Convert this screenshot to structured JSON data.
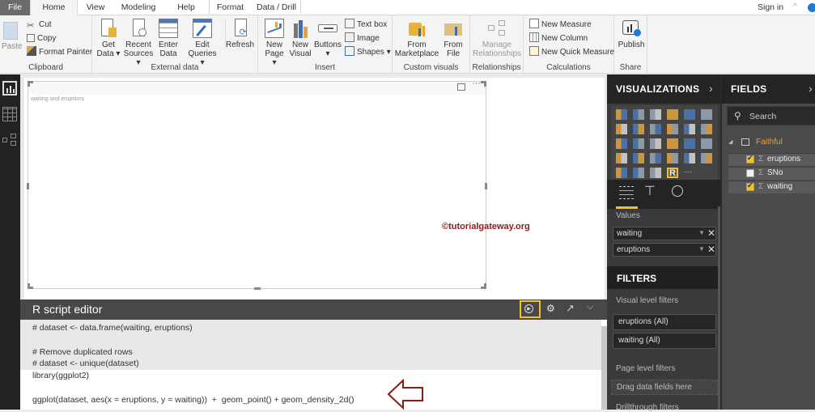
{
  "tabs": [
    "File",
    "Home",
    "View",
    "Modeling",
    "Help",
    "Format",
    "Data / Drill"
  ],
  "active_tab": "Home",
  "signin": "Sign in",
  "ribbon": {
    "clipboard": {
      "label": "Clipboard",
      "paste": "Paste",
      "cut": "Cut",
      "copy": "Copy",
      "format_painter": "Format Painter"
    },
    "external_data": {
      "label": "External data",
      "get_data": [
        "Get",
        "Data ▾"
      ],
      "recent_sources": [
        "Recent",
        "Sources ▾"
      ],
      "enter_data": [
        "Enter",
        "Data"
      ],
      "edit_queries": [
        "Edit",
        "Queries ▾"
      ],
      "refresh": "Refresh"
    },
    "insert": {
      "label": "Insert",
      "new_page": [
        "New",
        "Page ▾"
      ],
      "new_visual": [
        "New",
        "Visual"
      ],
      "buttons": [
        "Buttons",
        "▾"
      ],
      "text_box": "Text box",
      "image": "Image",
      "shapes": "Shapes ▾"
    },
    "custom_visuals": {
      "label": "Custom visuals",
      "from_marketplace": [
        "From",
        "Marketplace"
      ],
      "from_file": [
        "From",
        "File"
      ]
    },
    "relationships": {
      "label": "Relationships",
      "manage": [
        "Manage",
        "Relationships"
      ]
    },
    "calculations": {
      "label": "Calculations",
      "new_measure": "New Measure",
      "new_column": "New Column",
      "new_quick_measure": "New Quick Measure"
    },
    "share": {
      "label": "Share",
      "publish": "Publish"
    }
  },
  "canvas": {
    "visual_title": "waiting and eruptions",
    "watermark": "©tutorialgateway.org"
  },
  "r_editor": {
    "title": "R script editor",
    "lines": [
      "# dataset <- data.frame(waiting, eruptions)",
      "",
      "# Remove duplicated rows",
      "# dataset <- unique(dataset)",
      "library(ggplot2)",
      "",
      "ggplot(dataset, aes(x = eruptions, y = waiting))  +  geom_point() + geom_density_2d()"
    ]
  },
  "visualizations": {
    "title": "VISUALIZATIONS",
    "values_label": "Values",
    "values": [
      "waiting",
      "eruptions"
    ],
    "selected_visual": "R script visual"
  },
  "filters": {
    "title": "FILTERS",
    "visual_level_label": "Visual level filters",
    "visual_filters": [
      "eruptions  (All)",
      "waiting  (All)"
    ],
    "page_level_label": "Page level filters",
    "drop_hint": "Drag data fields here",
    "drillthrough_label": "Drillthrough filters"
  },
  "fields": {
    "title": "FIELDS",
    "search_placeholder": "Search",
    "table": "Faithful",
    "items": [
      {
        "name": "eruptions",
        "checked": true
      },
      {
        "name": "SNo",
        "checked": false
      },
      {
        "name": "waiting",
        "checked": true
      }
    ]
  },
  "colors": {
    "accent_yellow": "#f0c419",
    "table_orange": "#f29c2b",
    "watermark_red": "#8b1a1a"
  }
}
